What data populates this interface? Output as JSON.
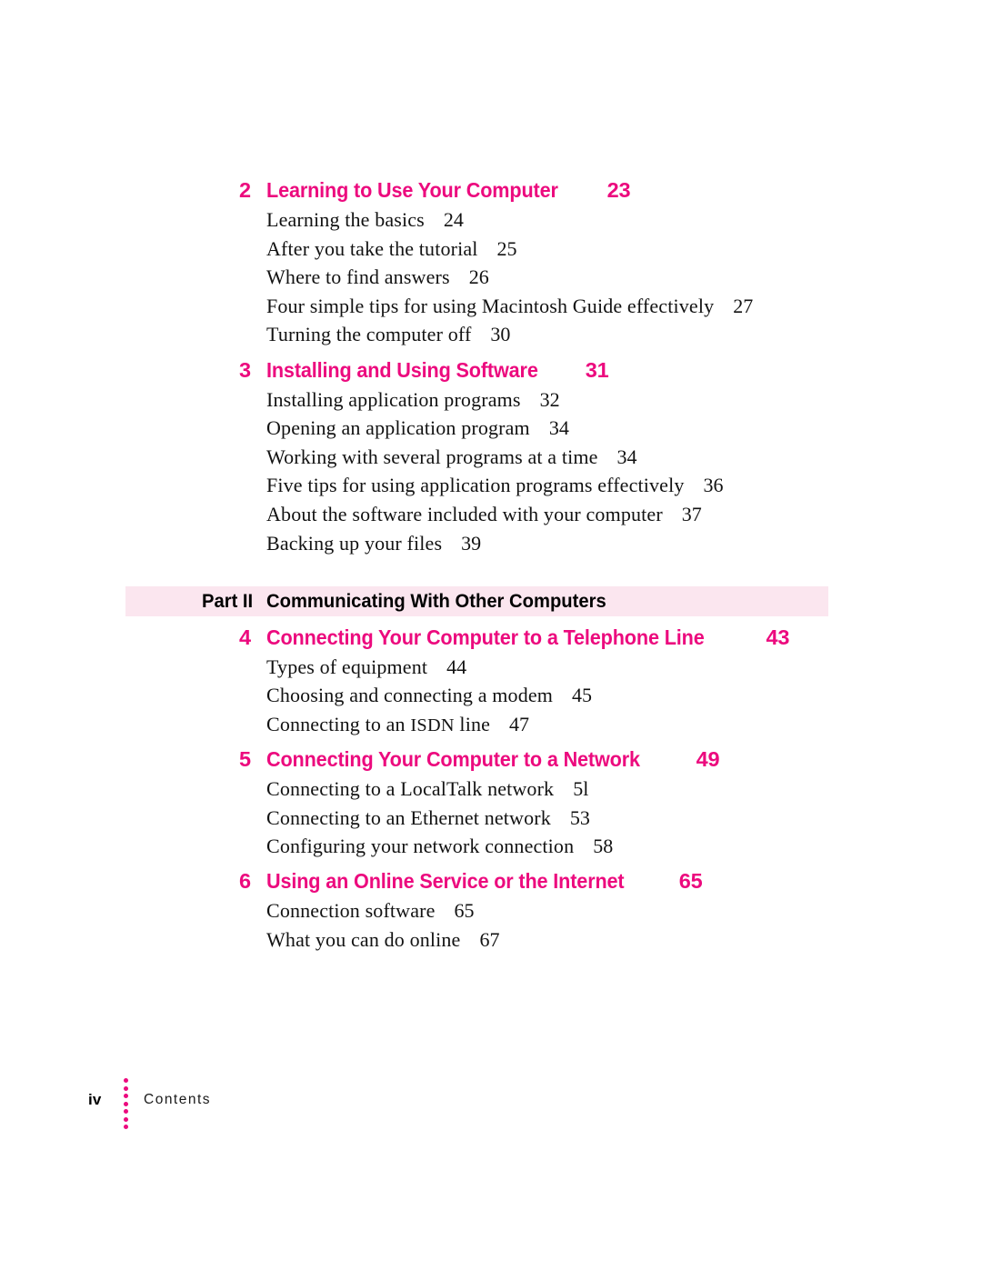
{
  "page": {
    "folio": "iv",
    "footer_label": "Contents",
    "accent_color": "#ec0a7e",
    "band_color": "#fbe6ef",
    "body_text_color": "#121212"
  },
  "toc": {
    "blocks": [
      {
        "kind": "chapter",
        "number": "2",
        "title": "Learning to Use Your Computer",
        "page": "23",
        "entries": [
          {
            "text": "Learning the basics",
            "page": "24"
          },
          {
            "text": "After you take the tutorial",
            "page": "25"
          },
          {
            "text": "Where to find answers",
            "page": "26"
          },
          {
            "text": "Four simple tips for using Macintosh Guide effectively",
            "page": "27"
          },
          {
            "text": "Turning the computer off",
            "page": "30"
          }
        ]
      },
      {
        "kind": "chapter",
        "number": "3",
        "title": "Installing and Using Software",
        "page": "31",
        "entries": [
          {
            "text": "Installing application programs",
            "page": "32"
          },
          {
            "text": "Opening an application program",
            "page": "34"
          },
          {
            "text": "Working with several programs at a time",
            "page": "34"
          },
          {
            "text": "Five tips for using application programs effectively",
            "page": "36"
          },
          {
            "text": "About the software included with your computer",
            "page": "37"
          },
          {
            "text": "Backing up your files",
            "page": "39"
          }
        ]
      },
      {
        "kind": "part",
        "label": "Part II",
        "title": "Communicating With Other Computers"
      },
      {
        "kind": "chapter",
        "number": "4",
        "title": "Connecting Your Computer to a Telephone Line",
        "page": "43",
        "entries": [
          {
            "text": "Types of equipment",
            "page": "44"
          },
          {
            "text": "Choosing and connecting a modem",
            "page": "45"
          },
          {
            "text_pre": "Connecting to an ",
            "text_caps": "ISDN",
            "text_post": " line",
            "page": "47"
          }
        ]
      },
      {
        "kind": "chapter",
        "number": "5",
        "title": "Connecting Your Computer to a Network",
        "page": "49",
        "entries": [
          {
            "text": "Connecting to a LocalTalk network",
            "page": "5l"
          },
          {
            "text": "Connecting to an Ethernet network",
            "page": "53"
          },
          {
            "text": "Configuring your network connection",
            "page": "58"
          }
        ]
      },
      {
        "kind": "chapter",
        "number": "6",
        "title": "Using an Online Service or the Internet",
        "page": "65",
        "entries": [
          {
            "text": "Connection software",
            "page": "65"
          },
          {
            "text": "What you can do online",
            "page": "67"
          }
        ]
      }
    ]
  }
}
